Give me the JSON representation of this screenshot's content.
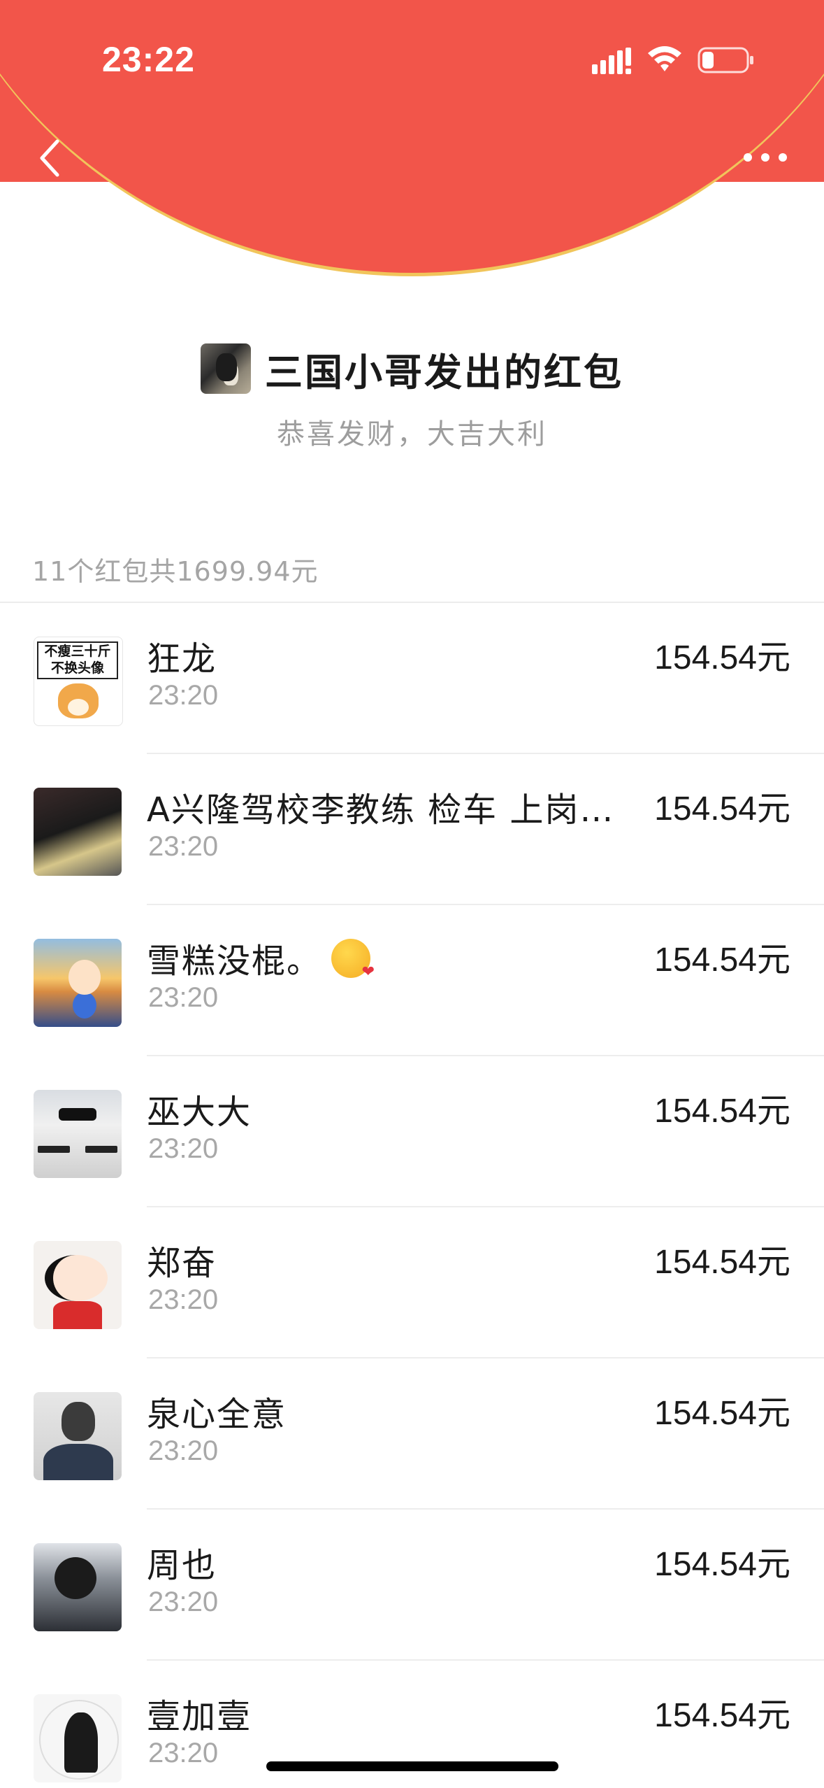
{
  "status_bar": {
    "time": "23:22"
  },
  "header": {
    "back_icon": "chevron-left-icon",
    "more_icon": "more-dots-icon",
    "background_color": "#F2554A",
    "curve_border_color": "#F1C55B"
  },
  "sender": {
    "title": "三国小哥发出的红包",
    "blessing": "恭喜发财，大吉大利"
  },
  "summary": {
    "text": "11个红包共1699.94元"
  },
  "records": [
    {
      "name": "狂龙",
      "time": "23:20",
      "amount": "154.54元",
      "avatar_text": [
        "不瘦三十斤",
        "不换头像"
      ]
    },
    {
      "name": "A兴隆驾校李教练 检车 上岗证…",
      "time": "23:20",
      "amount": "154.54元"
    },
    {
      "name": "雪糕没棍。",
      "time": "23:20",
      "amount": "154.54元",
      "emoji": "kissing-face-with-heart-icon"
    },
    {
      "name": "巫大大",
      "time": "23:20",
      "amount": "154.54元"
    },
    {
      "name": "郑奋",
      "time": "23:20",
      "amount": "154.54元"
    },
    {
      "name": "泉心全意",
      "time": "23:20",
      "amount": "154.54元"
    },
    {
      "name": "周也",
      "time": "23:20",
      "amount": "154.54元"
    },
    {
      "name": "壹加壹",
      "time": "23:20",
      "amount": "154.54元"
    }
  ]
}
